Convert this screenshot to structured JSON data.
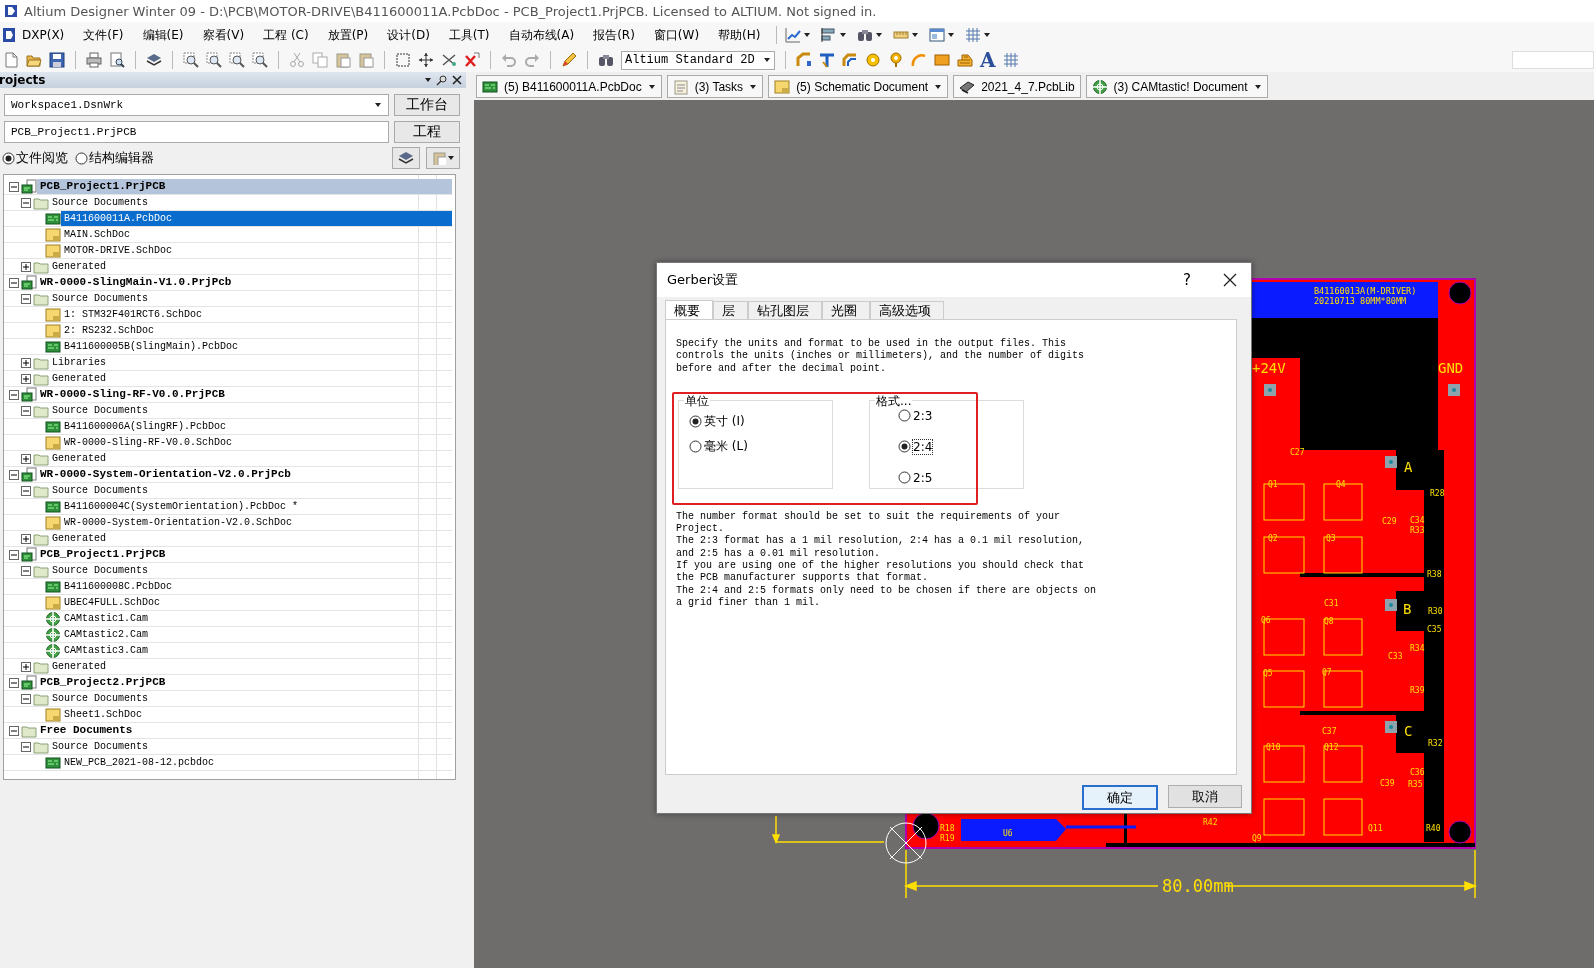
{
  "window": {
    "title": "Altium Designer Winter 09 - D:\\PCB\\MOTOR-DRIVE\\B411600011A.PcbDoc - PCB_Project1.PrjPCB. Licensed to ALTIUM. Not signed in."
  },
  "menu": [
    "DXP(X)",
    "文件(F)",
    "编辑(E)",
    "察看(V)",
    "工程 (C)",
    "放置(P)",
    "设计(D)",
    "工具(T)",
    "自动布线(A)",
    "报告(R)",
    "窗口(W)",
    "帮助(H)"
  ],
  "toolbar": {
    "view_mode": "Altium Standard 2D",
    "text_tool": "A"
  },
  "projects_panel": {
    "title": "rojects",
    "workspace": "Workspace1.DsnWrk",
    "workspace_button": "工作台",
    "project": "PCB_Project1.PrjPCB",
    "project_button": "工程",
    "views": [
      {
        "label": "文件阅览",
        "selected": true
      },
      {
        "label": "结构编辑器",
        "selected": false
      }
    ],
    "tree": [
      {
        "label": "PCB_Project1.PrjPCB",
        "kind": "project",
        "expanded": true,
        "selected": false,
        "active": true,
        "children": [
          {
            "label": "Source Documents",
            "kind": "folder",
            "expanded": true,
            "selected": false,
            "children": [
              {
                "label": "B411600011A.PcbDoc",
                "kind": "pcb",
                "selected": true
              },
              {
                "label": "MAIN.SchDoc",
                "kind": "sch",
                "selected": false
              },
              {
                "label": "MOTOR-DRIVE.SchDoc",
                "kind": "sch",
                "selected": false
              }
            ]
          },
          {
            "label": "Generated",
            "kind": "folder",
            "expanded": false,
            "selected": false
          }
        ]
      },
      {
        "label": "WR-0000-SlingMain-V1.0.PrjPcb",
        "kind": "project",
        "expanded": true,
        "selected": false,
        "active": false,
        "children": [
          {
            "label": "Source Documents",
            "kind": "folder",
            "expanded": true,
            "selected": false,
            "children": [
              {
                "label": "1: STM32F401RCT6.SchDoc",
                "kind": "sch",
                "selected": false
              },
              {
                "label": "2: RS232.SchDoc",
                "kind": "sch",
                "selected": false
              },
              {
                "label": "B411600005B(SlingMain).PcbDoc",
                "kind": "pcb",
                "selected": false
              }
            ]
          },
          {
            "label": "Libraries",
            "kind": "folder",
            "expanded": false,
            "selected": false
          },
          {
            "label": "Generated",
            "kind": "folder",
            "expanded": false,
            "selected": false
          }
        ]
      },
      {
        "label": "WR-0000-Sling-RF-V0.0.PrjPCB",
        "kind": "project",
        "expanded": true,
        "selected": false,
        "active": false,
        "children": [
          {
            "label": "Source Documents",
            "kind": "folder",
            "expanded": true,
            "selected": false,
            "children": [
              {
                "label": "B411600006A(SlingRF).PcbDoc",
                "kind": "pcb",
                "selected": false
              },
              {
                "label": "WR-0000-Sling-RF-V0.0.SchDoc",
                "kind": "sch",
                "selected": false
              }
            ]
          },
          {
            "label": "Generated",
            "kind": "folder",
            "expanded": false,
            "selected": false
          }
        ]
      },
      {
        "label": "WR-0000-System-Orientation-V2.0.PrjPcb",
        "kind": "project",
        "expanded": true,
        "selected": false,
        "active": false,
        "children": [
          {
            "label": "Source Documents",
            "kind": "folder",
            "expanded": true,
            "selected": false,
            "children": [
              {
                "label": "B411600004C(SystemOrientation).PcbDoc *",
                "kind": "pcb",
                "selected": false
              },
              {
                "label": "WR-0000-System-Orientation-V2.0.SchDoc",
                "kind": "sch",
                "selected": false
              }
            ]
          },
          {
            "label": "Generated",
            "kind": "folder",
            "expanded": false,
            "selected": false
          }
        ]
      },
      {
        "label": "PCB_Project1.PrjPCB",
        "kind": "project",
        "expanded": true,
        "selected": false,
        "active": false,
        "children": [
          {
            "label": "Source Documents",
            "kind": "folder",
            "expanded": true,
            "selected": false,
            "children": [
              {
                "label": "B411600008C.PcbDoc",
                "kind": "pcb",
                "selected": false
              },
              {
                "label": "UBEC4FULL.SchDoc",
                "kind": "sch",
                "selected": false
              },
              {
                "label": "CAMtastic1.Cam",
                "kind": "cam",
                "selected": false
              },
              {
                "label": "CAMtastic2.Cam",
                "kind": "cam",
                "selected": false
              },
              {
                "label": "CAMtastic3.Cam",
                "kind": "cam",
                "selected": false
              }
            ]
          },
          {
            "label": "Generated",
            "kind": "folder",
            "expanded": false,
            "selected": false
          }
        ]
      },
      {
        "label": "PCB_Project2.PrjPCB",
        "kind": "project",
        "expanded": true,
        "selected": false,
        "active": false,
        "children": [
          {
            "label": "Source Documents",
            "kind": "folder",
            "expanded": true,
            "selected": false,
            "children": [
              {
                "label": "Sheet1.SchDoc",
                "kind": "sch",
                "selected": false
              }
            ]
          }
        ]
      },
      {
        "label": "Free Documents",
        "kind": "group",
        "expanded": true,
        "selected": false,
        "active": false,
        "children": [
          {
            "label": "Source Documents",
            "kind": "folder",
            "expanded": true,
            "selected": false,
            "children": [
              {
                "label": "NEW_PCB_2021-08-12.pcbdoc",
                "kind": "pcb",
                "selected": false
              }
            ]
          }
        ]
      }
    ]
  },
  "doc_tabs": [
    {
      "label": "(5) B411600011A.PcbDoc",
      "kind": "pcb",
      "dropdown": true
    },
    {
      "label": "(3) Tasks",
      "kind": "tasks",
      "dropdown": true
    },
    {
      "label": "(5) Schematic Document",
      "kind": "sch",
      "dropdown": true
    },
    {
      "label": "2021_4_7.PcbLib",
      "kind": "lib",
      "dropdown": false
    },
    {
      "label": "(3) CAMtastic! Document",
      "kind": "cam",
      "dropdown": true
    }
  ],
  "pcb": {
    "board_title": [
      "B41160013A(M-DRIVER)",
      "20210713  80MM*80MM"
    ],
    "net_labels": [
      "+24V",
      "GND"
    ],
    "phase_labels": [
      "A",
      "B",
      "C"
    ],
    "designators": [
      "C27",
      "Q1",
      "Q4",
      "R28",
      "C29",
      "C34",
      "R33",
      "Q2",
      "Q3",
      "R38",
      "C31",
      "R30",
      "Q6",
      "Q8",
      "C35",
      "R34",
      "C33",
      "Q5",
      "Q7",
      "R39",
      "C37",
      "R32",
      "Q10",
      "Q12",
      "C36",
      "C39",
      "R35",
      "R42",
      "Q11",
      "R40",
      "Q9",
      "R18",
      "R19",
      "U6"
    ],
    "dimension": "80.00mm"
  },
  "dialog": {
    "title": "Gerber设置",
    "help": "?",
    "tabs": [
      {
        "label": "概要",
        "selected": true
      },
      {
        "label": "层",
        "selected": false
      },
      {
        "label": "钻孔图层",
        "selected": false
      },
      {
        "label": "光圈",
        "selected": false
      },
      {
        "label": "高级选项",
        "selected": false
      }
    ],
    "intro": "Specify the units and format to be used in the output files. This\ncontrols the units (inches or millimeters), and the number of digits\nbefore and after the decimal point.",
    "units": {
      "title": "单位",
      "options": [
        {
          "label": "英寸 (I)",
          "selected": true
        },
        {
          "label": "毫米 (L)",
          "selected": false
        }
      ]
    },
    "format": {
      "title": "格式...",
      "options": [
        {
          "label": "2:3",
          "selected": false
        },
        {
          "label": "2:4",
          "selected": true
        },
        {
          "label": "2:5",
          "selected": false
        }
      ]
    },
    "notes": "The number format should be set to suit the requirements of your\nProject.\nThe 2:3 format has a 1 mil resolution, 2:4 has a 0.1 mil resolution,\nand 2:5 has a 0.01 mil resolution.\nIf you are using one of the higher resolutions you should check that\nthe PCB manufacturer supports that format.\nThe 2:4 and 2:5 formats only need to be chosen if there are objects on\na grid finer than 1 mil.",
    "buttons": [
      {
        "label": "确定",
        "default": true
      },
      {
        "label": "取消",
        "default": false
      }
    ]
  }
}
